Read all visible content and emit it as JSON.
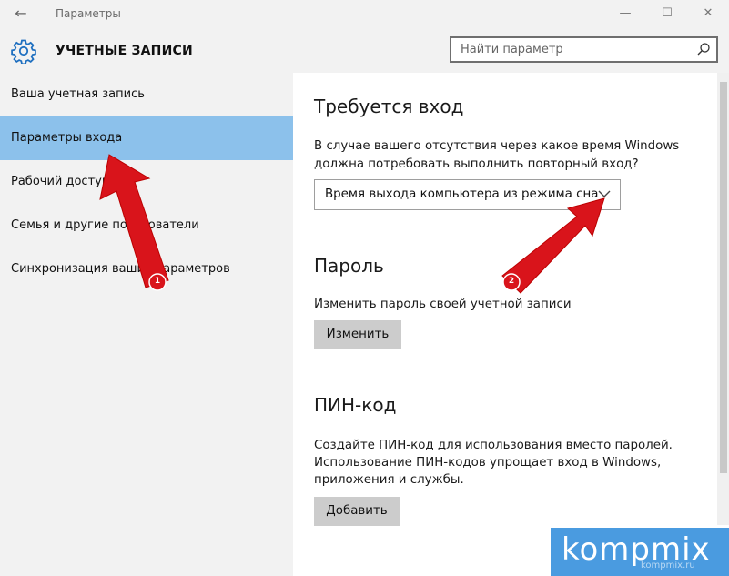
{
  "window": {
    "title": "Параметры",
    "back_glyph": "←",
    "minimize_glyph": "—",
    "maximize_glyph": "☐",
    "close_glyph": "✕"
  },
  "header": {
    "section_title": "УЧЕТНЫЕ ЗАПИСИ",
    "search_placeholder": "Найти параметр"
  },
  "sidebar": {
    "items": [
      {
        "label": "Ваша учетная запись",
        "selected": false
      },
      {
        "label": "Параметры входа",
        "selected": true
      },
      {
        "label": "Рабочий доступ",
        "selected": false
      },
      {
        "label": "Семья и другие пользователи",
        "selected": false
      },
      {
        "label": "Синхронизация ваших параметров",
        "selected": false
      }
    ]
  },
  "main": {
    "signin": {
      "heading": "Требуется вход",
      "line1": "В случае вашего отсутствия через какое время Windows",
      "line2": "должна потребовать выполнить повторный вход?",
      "dropdown_value": "Время выхода компьютера из режима сна"
    },
    "password": {
      "heading": "Пароль",
      "description": "Изменить пароль своей учетной записи",
      "button": "Изменить"
    },
    "pin": {
      "heading": "ПИН-код",
      "line1": "Создайте ПИН-код для использования вместо паролей.",
      "line2": "Использование ПИН-кодов упрощает вход в Windows,",
      "line3": "приложения и службы.",
      "button": "Добавить"
    }
  },
  "annotations": {
    "arrow_color": "#d9141b",
    "badge1": "1",
    "badge2": "2"
  },
  "watermark": {
    "text": "kompmix",
    "small": "kompmix.ru"
  },
  "colors": {
    "accent_selected": "#8cc1eb",
    "button_bg": "#cccccc",
    "watermark_bg": "#4a9be0"
  }
}
